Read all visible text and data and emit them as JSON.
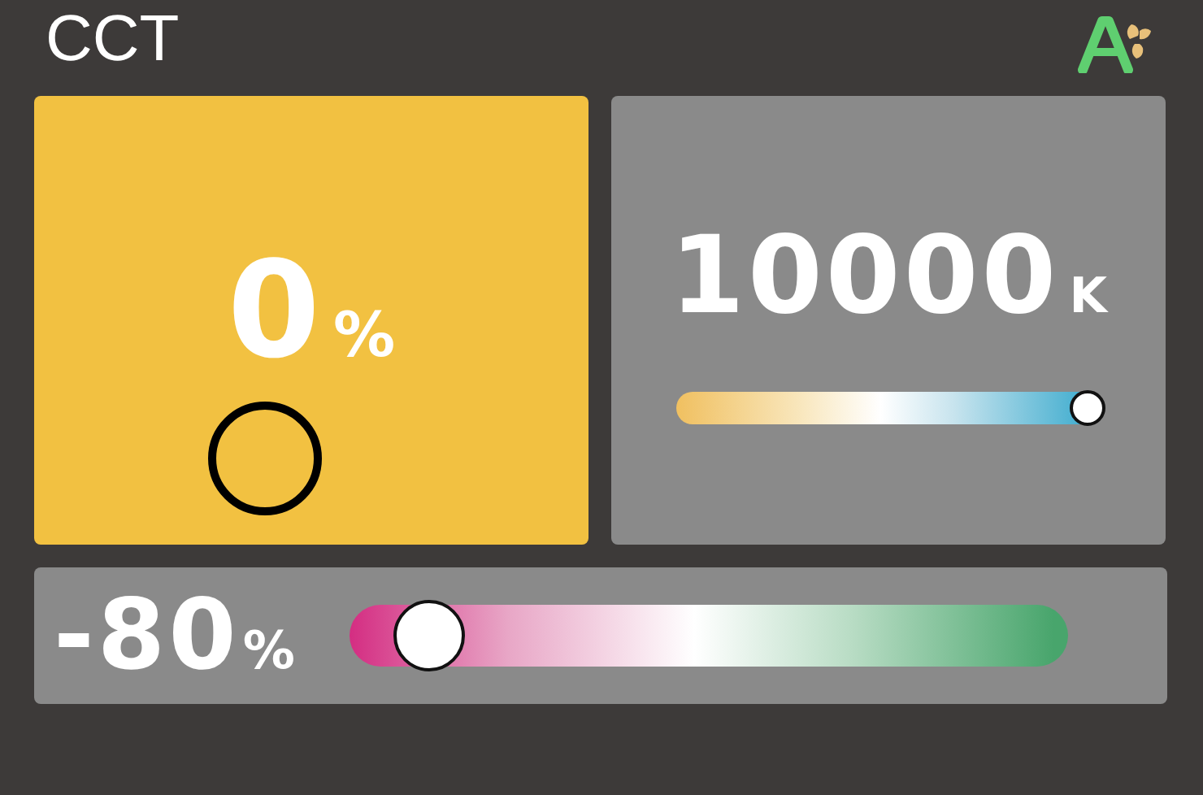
{
  "header": {
    "title": "CCT"
  },
  "intensity": {
    "value": "0",
    "unit": "%"
  },
  "cct": {
    "value": "10000",
    "unit": "K",
    "level": 1.0
  },
  "tint": {
    "value": "-80",
    "unit": "%",
    "level": 0.07
  }
}
